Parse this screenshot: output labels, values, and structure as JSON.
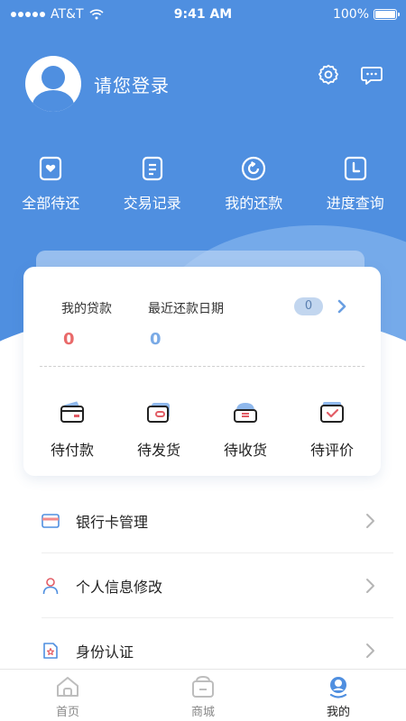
{
  "status_bar": {
    "carrier": "AT&T",
    "time": "9:41 AM",
    "battery": "100%"
  },
  "header": {
    "login_text": "请您登录",
    "quick_nav": [
      {
        "label": "全部待还",
        "icon": "heart-card-icon"
      },
      {
        "label": "交易记录",
        "icon": "document-icon"
      },
      {
        "label": "我的还款",
        "icon": "refresh-icon"
      },
      {
        "label": "进度查询",
        "icon": "clock-icon"
      }
    ]
  },
  "loan_card": {
    "my_loan_label": "我的贷款",
    "my_loan_value": "0",
    "recent_repay_label": "最近还款日期",
    "recent_repay_value": "0",
    "badge_count": "0"
  },
  "orders": [
    {
      "label": "待付款",
      "icon": "wallet-icon"
    },
    {
      "label": "待发货",
      "icon": "package-icon"
    },
    {
      "label": "待收货",
      "icon": "receive-icon"
    },
    {
      "label": "待评价",
      "icon": "review-icon"
    }
  ],
  "menu": [
    {
      "label": "银行卡管理",
      "icon": "bank-card-icon"
    },
    {
      "label": "个人信息修改",
      "icon": "person-icon"
    },
    {
      "label": "身份认证",
      "icon": "id-verify-icon"
    }
  ],
  "tabbar": [
    {
      "label": "首页",
      "icon": "home-icon",
      "active": false
    },
    {
      "label": "商城",
      "icon": "shop-icon",
      "active": false
    },
    {
      "label": "我的",
      "icon": "profile-icon",
      "active": true
    }
  ],
  "colors": {
    "primary": "#4f8fe0",
    "loan_value": "#e96a6a",
    "repay_value": "#7aaae6",
    "order_icon": "#e25d66"
  }
}
